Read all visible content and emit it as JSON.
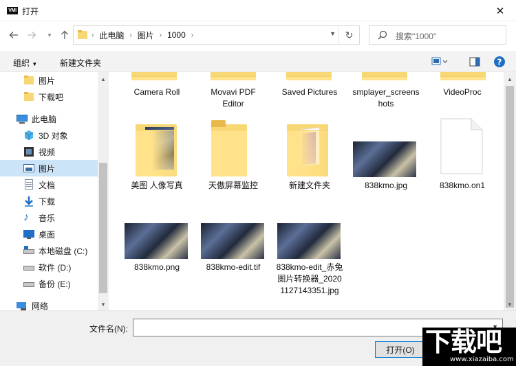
{
  "window": {
    "title": "打开",
    "app_icon_label": "VMI"
  },
  "address": {
    "crumbs": [
      "此电脑",
      "图片",
      "1000"
    ]
  },
  "search": {
    "placeholder": "搜索\"1000\""
  },
  "toolbar": {
    "organize": "组织",
    "new_folder": "新建文件夹"
  },
  "nav": {
    "items": [
      {
        "label": "图片",
        "icon": "folder-icon"
      },
      {
        "label": "下载吧",
        "icon": "folder-icon"
      },
      {
        "label": "此电脑",
        "icon": "computer-icon"
      },
      {
        "label": "3D 对象",
        "icon": "cube-icon"
      },
      {
        "label": "视频",
        "icon": "film-icon"
      },
      {
        "label": "图片",
        "icon": "picture-icon"
      },
      {
        "label": "文档",
        "icon": "document-icon"
      },
      {
        "label": "下载",
        "icon": "download-arrow-icon"
      },
      {
        "label": "音乐",
        "icon": "music-note-icon"
      },
      {
        "label": "桌面",
        "icon": "desktop-icon"
      },
      {
        "label": "本地磁盘 (C:)",
        "icon": "drive-icon"
      },
      {
        "label": "软件 (D:)",
        "icon": "drive-icon"
      },
      {
        "label": "备份 (E:)",
        "icon": "drive-icon"
      },
      {
        "label": "网络",
        "icon": "network-icon"
      }
    ]
  },
  "files": {
    "row1": [
      {
        "name": "Camera Roll"
      },
      {
        "name": "Movavi PDF Editor"
      },
      {
        "name": "Saved Pictures"
      },
      {
        "name": "smplayer_screenshots"
      },
      {
        "name": "VideoProc"
      }
    ],
    "row2": [
      {
        "name": "美图 人像写真",
        "kind": "folder-with-image"
      },
      {
        "name": "天傲屏幕监控",
        "kind": "folder"
      },
      {
        "name": "新建文件夹",
        "kind": "folder-with-docs"
      },
      {
        "name": "838kmo.jpg",
        "kind": "image"
      },
      {
        "name": "838kmo.on1",
        "kind": "blank-file"
      }
    ],
    "row3": [
      {
        "name": "838kmo.png",
        "kind": "image"
      },
      {
        "name": "838kmo-edit.tif",
        "kind": "image"
      },
      {
        "name": "838kmo-edit_赤兔图片转换器_20201127143351.jpg",
        "kind": "image"
      }
    ]
  },
  "bottom": {
    "filename_label": "文件名(N):",
    "filename_value": "",
    "open_label": "打开(O)"
  },
  "watermark": {
    "big": "下载吧",
    "small": "www.xiazaiba.com"
  }
}
